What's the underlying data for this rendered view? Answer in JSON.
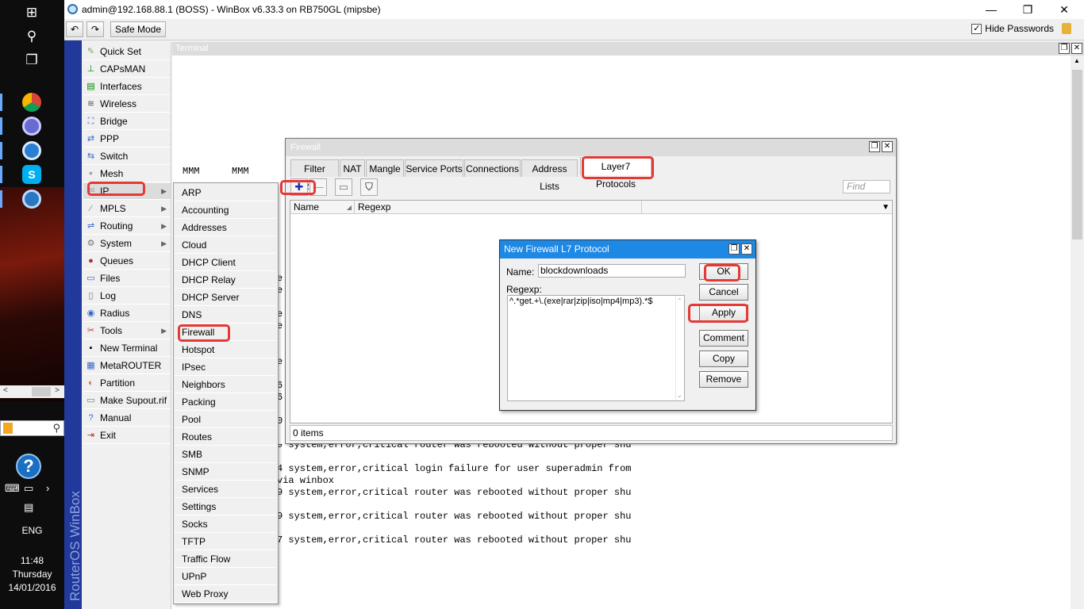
{
  "window": {
    "title": "admin@192.168.88.1 (BOSS) - WinBox v6.33.3 on RB750GL (mipsbe)",
    "minimize": "—",
    "maximize": "❐",
    "close": "✕"
  },
  "toolbar": {
    "undo_icon": "↶",
    "redo_icon": "↷",
    "safe_mode": "Safe Mode",
    "hide_passwords": "Hide Passwords",
    "hide_passwords_checked": "✓"
  },
  "brand": "RouterOS WinBox",
  "main_menu": [
    {
      "label": "Quick Set",
      "icon": "✎",
      "color": "#7a5"
    },
    {
      "label": "CAPsMAN",
      "icon": "⊥",
      "color": "#080"
    },
    {
      "label": "Interfaces",
      "icon": "▤",
      "color": "#080"
    },
    {
      "label": "Wireless",
      "icon": "≋",
      "color": "#555"
    },
    {
      "label": "Bridge",
      "icon": "⛶",
      "color": "#36c"
    },
    {
      "label": "PPP",
      "icon": "⇄",
      "color": "#36c"
    },
    {
      "label": "Switch",
      "icon": "⇆",
      "color": "#36c"
    },
    {
      "label": "Mesh",
      "icon": "∘",
      "color": "#555"
    },
    {
      "label": "IP",
      "icon": "255",
      "color": "#888",
      "arrow": "▶"
    },
    {
      "label": "MPLS",
      "icon": "⁄",
      "color": "#888",
      "arrow": "▶"
    },
    {
      "label": "Routing",
      "icon": "⇌",
      "color": "#36c",
      "arrow": "▶"
    },
    {
      "label": "System",
      "icon": "⚙",
      "color": "#777",
      "arrow": "▶"
    },
    {
      "label": "Queues",
      "icon": "●",
      "color": "#a33"
    },
    {
      "label": "Files",
      "icon": "▭",
      "color": "#36c"
    },
    {
      "label": "Log",
      "icon": "▯",
      "color": "#777"
    },
    {
      "label": "Radius",
      "icon": "◉",
      "color": "#36c"
    },
    {
      "label": "Tools",
      "icon": "✂",
      "color": "#c33",
      "arrow": "▶"
    },
    {
      "label": "New Terminal",
      "icon": "▪",
      "color": "#000"
    },
    {
      "label": "MetaROUTER",
      "icon": "▦",
      "color": "#36c"
    },
    {
      "label": "Partition",
      "icon": "◐",
      "color": "#c63"
    },
    {
      "label": "Make Supout.rif",
      "icon": "▭",
      "color": "#777"
    },
    {
      "label": "Manual",
      "icon": "?",
      "color": "#36c"
    },
    {
      "label": "Exit",
      "icon": "⇥",
      "color": "#a33"
    }
  ],
  "ip_submenu": [
    "ARP",
    "Accounting",
    "Addresses",
    "Cloud",
    "DHCP Client",
    "DHCP Relay",
    "DHCP Server",
    "DNS",
    "Firewall",
    "Hotspot",
    "IPsec",
    "Neighbors",
    "Packing",
    "Pool",
    "Routes",
    "SMB",
    "SNMP",
    "Services",
    "Settings",
    "Socks",
    "TFTP",
    "Traffic Flow",
    "UPnP",
    "Web Proxy"
  ],
  "terminal": {
    "title": "Terminal",
    "mmm_1": "MMM",
    "mmm_2": "MMM",
    "partial_chars": [
      "e",
      "e",
      "e",
      "e",
      "e",
      "6",
      "6",
      "0"
    ],
    "lines": [
      "9 system,error,critical router was rebooted without proper shu",
      "4 system,error,critical login failure for user superadmin from",
      "via winbox",
      "9 system,error,critical router was rebooted without proper shu",
      "9 system,error,critical router was rebooted without proper shu",
      "7 system,error,critical router was rebooted without proper shu"
    ]
  },
  "firewall": {
    "title": "Firewall",
    "tabs": [
      "Filter Rules",
      "NAT",
      "Mangle",
      "Service Ports",
      "Connections",
      "Address Lists",
      "Layer7 Protocols"
    ],
    "find_placeholder": "Find",
    "columns": [
      "Name",
      "Regexp"
    ],
    "status": "0 items",
    "add_icon": "✚",
    "remove_icon": "—",
    "comment_icon": "▭",
    "filter_icon": "⛉",
    "sort_icon": "◢",
    "dropdown_icon": "▼"
  },
  "l7_dialog": {
    "title": "New Firewall L7 Protocol",
    "name_label": "Name:",
    "name_value": "blockdownloads",
    "regexp_label": "Regexp:",
    "regexp_value": "^.*get.+\\.(exe|rar|zip|iso|mp4|mp3).*$",
    "buttons": {
      "ok": "OK",
      "cancel": "Cancel",
      "apply": "Apply",
      "comment": "Comment",
      "copy": "Copy",
      "remove": "Remove"
    }
  },
  "taskbar": {
    "language": "ENG",
    "time": "11:48",
    "day": "Thursday",
    "date": "14/01/2016",
    "help": "?",
    "scroll_left": "<",
    "scroll_right": ">"
  },
  "colors": {
    "annotation": "#e53935",
    "brand_strip": "#20399a",
    "dialog_title": "#1e88e5"
  }
}
